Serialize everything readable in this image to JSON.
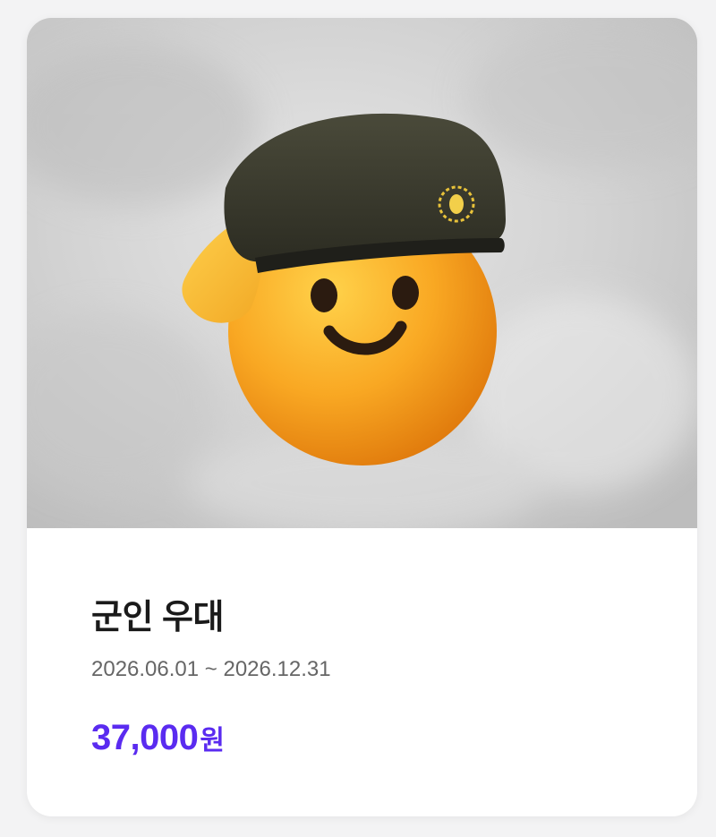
{
  "product": {
    "title": "군인 우대",
    "period": "2026.06.01 ~ 2026.12.31",
    "price_amount": "37,000",
    "price_unit": "원"
  },
  "image": {
    "icon": "saluting-smiley-beret-icon",
    "background": "grey-watercolor"
  },
  "colors": {
    "accent": "#5a2bf0",
    "title": "#1a1a1a",
    "muted": "#666666",
    "card_bg": "#ffffff",
    "page_bg": "#f3f3f4"
  }
}
